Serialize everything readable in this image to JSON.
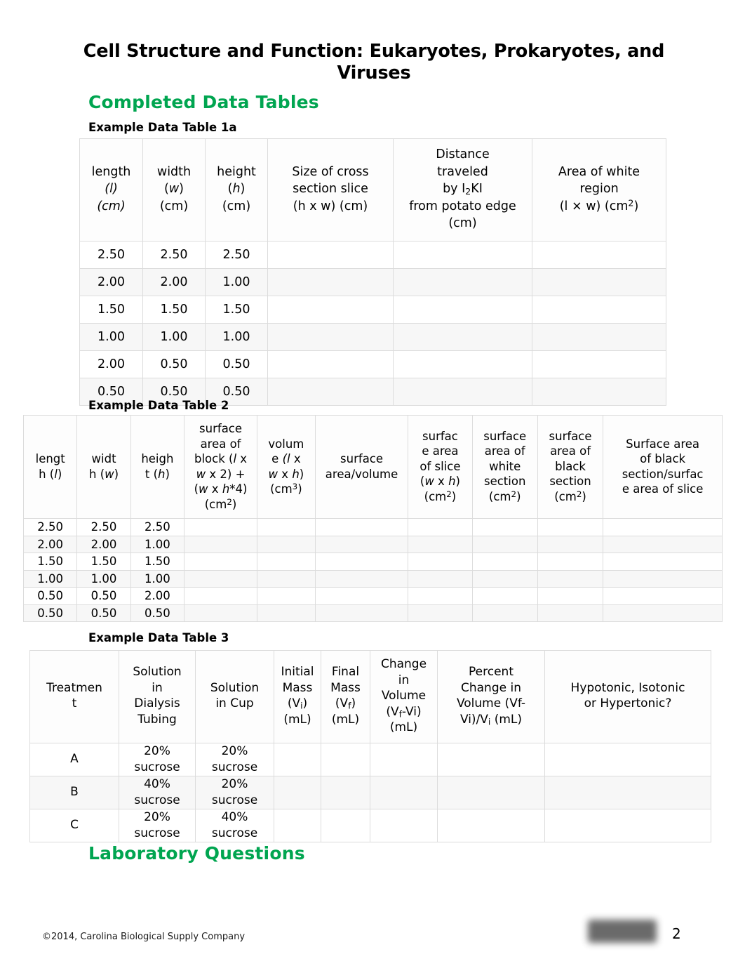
{
  "document": {
    "title": "Cell Structure and Function: Eukaryotes, Prokaryotes, and Viruses",
    "section_completed": "Completed Data Tables",
    "section_lab_questions": "Laboratory Questions",
    "accent_color": "#00a550",
    "border_color": "#dcdcdc"
  },
  "table1a": {
    "caption": "Example Data Table 1a",
    "headers": [
      {
        "line1": "length",
        "line2": "(l)",
        "line3": "(cm)"
      },
      {
        "line1": "width",
        "line2": "(w)",
        "line3": "(cm)"
      },
      {
        "line1": "height",
        "line2": "(h)",
        "line3": "(cm)"
      },
      {
        "line1": "Size of cross",
        "line2": "section slice",
        "line3": "(h x w) (cm)"
      },
      {
        "line1": "Distance",
        "line2": "traveled",
        "line3": "by I2KI",
        "line4": "from potato edge",
        "line5": "(cm)"
      },
      {
        "line1": "Area of white",
        "line2": "region",
        "line3": "(l × w) (cm2)"
      }
    ],
    "rows": [
      {
        "length": "2.50",
        "width": "2.50",
        "height": "2.50",
        "cross_section": "",
        "distance": "",
        "white_area": ""
      },
      {
        "length": "2.00",
        "width": "2.00",
        "height": "1.00",
        "cross_section": "",
        "distance": "",
        "white_area": ""
      },
      {
        "length": "1.50",
        "width": "1.50",
        "height": "1.50",
        "cross_section": "",
        "distance": "",
        "white_area": ""
      },
      {
        "length": "1.00",
        "width": "1.00",
        "height": "1.00",
        "cross_section": "",
        "distance": "",
        "white_area": ""
      },
      {
        "length": "2.00",
        "width": "0.50",
        "height": "0.50",
        "cross_section": "",
        "distance": "",
        "white_area": ""
      },
      {
        "length": "0.50",
        "width": "0.50",
        "height": "0.50",
        "cross_section": "",
        "distance": "",
        "white_area": ""
      }
    ]
  },
  "table2": {
    "caption": "Example Data Table 2",
    "headers": [
      {
        "text": "length (l)"
      },
      {
        "text": "width (w)"
      },
      {
        "text": "height (h)"
      },
      {
        "text": "surface area of block (l x w x 2) + (w x h*4) (cm2)"
      },
      {
        "text": "volume (l x w x h) (cm3)"
      },
      {
        "text": "surface area/volume"
      },
      {
        "text": "surface area of slice (w x h) (cm2)"
      },
      {
        "text": "surface area of white section (cm2)"
      },
      {
        "text": "surface area of black section (cm2)"
      },
      {
        "text": "Surface area of black section/surface area of slice"
      }
    ],
    "rows": [
      {
        "length": "2.50",
        "width": "2.50",
        "height": "2.50"
      },
      {
        "length": "2.00",
        "width": "2.00",
        "height": "1.00"
      },
      {
        "length": "1.50",
        "width": "1.50",
        "height": "1.50"
      },
      {
        "length": "1.00",
        "width": "1.00",
        "height": "1.00"
      },
      {
        "length": "0.50",
        "width": "0.50",
        "height": "2.00"
      },
      {
        "length": "0.50",
        "width": "0.50",
        "height": "0.50"
      }
    ]
  },
  "table3": {
    "caption": "Example Data Table 3",
    "headers": [
      {
        "text": "Treatment"
      },
      {
        "text": "Solution in Dialysis Tubing"
      },
      {
        "text": "Solution in Cup"
      },
      {
        "text": "Initial Mass (Vi) (mL)"
      },
      {
        "text": "Final Mass (Vf) (mL)"
      },
      {
        "text": "Change in Volume (Vf-Vi) (mL)"
      },
      {
        "text": "Percent Change in Volume (Vf-Vi)/Vi (mL)"
      },
      {
        "text": "Hypotonic, Isotonic or Hypertonic?"
      }
    ],
    "rows": [
      {
        "treatment": "A",
        "tubing": "20% sucrose",
        "cup": "20% sucrose",
        "initial_mass": "",
        "final_mass": "",
        "change_volume": "",
        "percent_change": "",
        "tonicity": ""
      },
      {
        "treatment": "B",
        "tubing": "40% sucrose",
        "cup": "20% sucrose",
        "initial_mass": "",
        "final_mass": "",
        "change_volume": "",
        "percent_change": "",
        "tonicity": ""
      },
      {
        "treatment": "C",
        "tubing": "20% sucrose",
        "cup": "40% sucrose",
        "initial_mass": "",
        "final_mass": "",
        "change_volume": "",
        "percent_change": "",
        "tonicity": ""
      }
    ]
  },
  "footer": {
    "copyright": "©2014, Carolina Biological Supply Company",
    "page_number": "2",
    "logo": "redacted-logo"
  }
}
